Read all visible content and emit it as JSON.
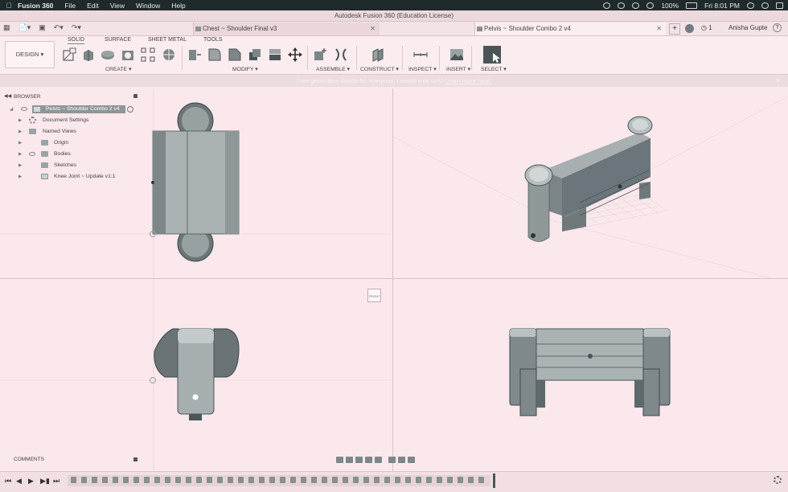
{
  "menubar": {
    "app_name": "Fusion 360",
    "items": [
      "File",
      "Edit",
      "View",
      "Window",
      "Help"
    ],
    "battery": "100%",
    "clock": "Fri 8:01 PM"
  },
  "window": {
    "title": "Autodesk Fusion 360 (Education License)"
  },
  "tabs": [
    {
      "label": "Chest ~ Shoulder Final v3",
      "active": false
    },
    {
      "label": "Pelvis ~ Shoulder Combo 2 v4",
      "active": true
    }
  ],
  "header": {
    "job_count": "1",
    "user_name": "Anisha Gupte"
  },
  "toolbar": {
    "workspace": "DESIGN",
    "workspace_tabs": [
      "SOLID",
      "SURFACE",
      "SHEET METAL",
      "TOOLS"
    ],
    "groups": [
      "CREATE",
      "MODIFY",
      "ASSEMBLE",
      "CONSTRUCT",
      "INSPECT",
      "INSERT",
      "SELECT"
    ]
  },
  "banner": {
    "text": "Free generative design for everyone. Limited time only.",
    "link": "Learn more here."
  },
  "browser": {
    "title": "BROWSER",
    "root": "Pelvis ~ Shoulder Combo 2 v4",
    "items": [
      {
        "label": "Document Settings"
      },
      {
        "label": "Named Views"
      },
      {
        "label": "Origin"
      },
      {
        "label": "Bodies"
      },
      {
        "label": "Sketches"
      },
      {
        "label": "Knee Joint ~ Update v1:1"
      }
    ]
  },
  "viewport": {
    "viewcube_label": "FRONT"
  },
  "comments": {
    "title": "COMMENTS"
  },
  "colors": {
    "background": "#fae8ec",
    "menubar": "#1f2a2c",
    "model_fill": "#7d8789",
    "model_dark": "#4b5557"
  }
}
